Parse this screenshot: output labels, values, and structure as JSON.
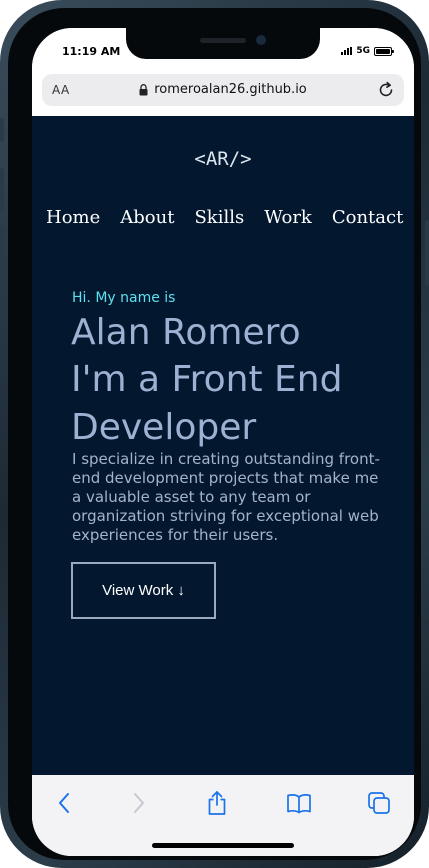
{
  "status_bar": {
    "time": "11:19 AM",
    "network": "5G"
  },
  "browser": {
    "text_size_label": "AA",
    "url": "romeroalan26.github.io"
  },
  "site": {
    "logo": "<AR/>",
    "nav": [
      {
        "label": "Home"
      },
      {
        "label": "About"
      },
      {
        "label": "Skills"
      },
      {
        "label": "Work"
      },
      {
        "label": "Contact"
      }
    ],
    "hero": {
      "greeting": "Hi. My name is",
      "name": "Alan Romero",
      "role": "I'm a Front End Developer",
      "bio": "I specialize in creating outstanding front-end development projects that make me a valuable asset to any team or organization striving for exceptional web experiences for their users.",
      "cta_label": "View Work ↓"
    }
  },
  "toolbar": {
    "icons": [
      "back-icon",
      "forward-icon",
      "share-icon",
      "bookmarks-icon",
      "tabs-icon"
    ]
  },
  "colors": {
    "page_bg": "#03182f",
    "accent": "#5fe0f1",
    "heading": "#9db2d3",
    "toolbar_icon": "#1a73e8"
  }
}
